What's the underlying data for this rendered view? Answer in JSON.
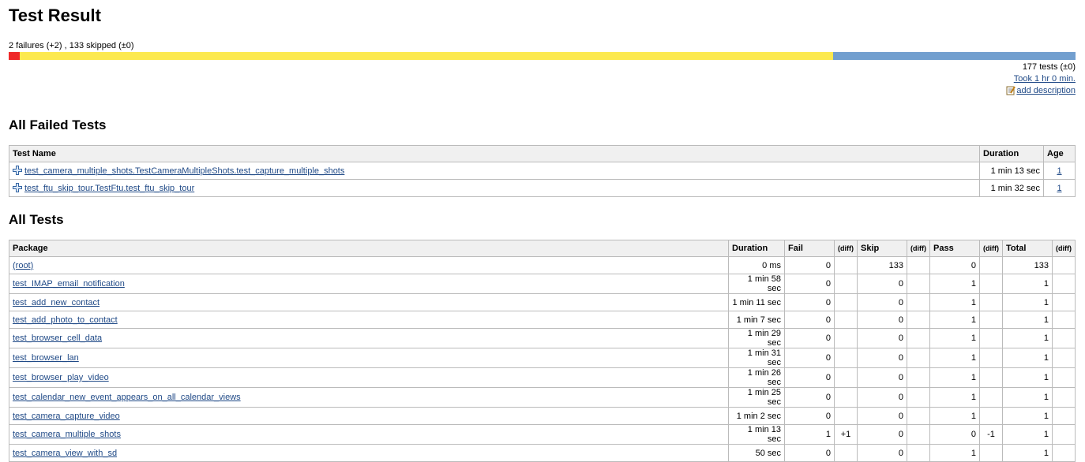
{
  "page_title": "Test Result",
  "summary_text": "2 failures (+2) , 133 skipped (±0)",
  "progress": {
    "fail_fraction": 0.0104,
    "skip_fraction": 0.7625,
    "pass_fraction": 0.2271,
    "colors": {
      "fail": "#ef2929",
      "skip": "#fce94f",
      "pass": "#729fcf"
    }
  },
  "tests_total_text": "177 tests (±0)",
  "took_text": "Took 1 hr 0 min.",
  "add_description": "add description",
  "failed_section": {
    "title": "All Failed Tests",
    "headers": {
      "name": "Test Name",
      "duration": "Duration",
      "age": "Age"
    },
    "rows": [
      {
        "name": "test_camera_multiple_shots.TestCameraMultipleShots.test_capture_multiple_shots",
        "duration": "1 min 13 sec",
        "age": "1"
      },
      {
        "name": "test_ftu_skip_tour.TestFtu.test_ftu_skip_tour",
        "duration": "1 min 32 sec",
        "age": "1"
      }
    ]
  },
  "all_section": {
    "title": "All Tests",
    "headers": {
      "package": "Package",
      "duration": "Duration",
      "fail": "Fail",
      "diff": "(diff)",
      "skip": "Skip",
      "pass": "Pass",
      "total": "Total"
    },
    "rows": [
      {
        "package": "(root)",
        "duration": "0 ms",
        "fail": "0",
        "fail_diff": "",
        "skip": "133",
        "skip_diff": "",
        "pass": "0",
        "pass_diff": "",
        "total": "133",
        "total_diff": ""
      },
      {
        "package": "test_IMAP_email_notification",
        "duration": "1 min 58 sec",
        "fail": "0",
        "fail_diff": "",
        "skip": "0",
        "skip_diff": "",
        "pass": "1",
        "pass_diff": "",
        "total": "1",
        "total_diff": ""
      },
      {
        "package": "test_add_new_contact",
        "duration": "1 min 11 sec",
        "fail": "0",
        "fail_diff": "",
        "skip": "0",
        "skip_diff": "",
        "pass": "1",
        "pass_diff": "",
        "total": "1",
        "total_diff": ""
      },
      {
        "package": "test_add_photo_to_contact",
        "duration": "1 min 7 sec",
        "fail": "0",
        "fail_diff": "",
        "skip": "0",
        "skip_diff": "",
        "pass": "1",
        "pass_diff": "",
        "total": "1",
        "total_diff": ""
      },
      {
        "package": "test_browser_cell_data",
        "duration": "1 min 29 sec",
        "fail": "0",
        "fail_diff": "",
        "skip": "0",
        "skip_diff": "",
        "pass": "1",
        "pass_diff": "",
        "total": "1",
        "total_diff": ""
      },
      {
        "package": "test_browser_lan",
        "duration": "1 min 31 sec",
        "fail": "0",
        "fail_diff": "",
        "skip": "0",
        "skip_diff": "",
        "pass": "1",
        "pass_diff": "",
        "total": "1",
        "total_diff": ""
      },
      {
        "package": "test_browser_play_video",
        "duration": "1 min 26 sec",
        "fail": "0",
        "fail_diff": "",
        "skip": "0",
        "skip_diff": "",
        "pass": "1",
        "pass_diff": "",
        "total": "1",
        "total_diff": ""
      },
      {
        "package": "test_calendar_new_event_appears_on_all_calendar_views",
        "duration": "1 min 25 sec",
        "fail": "0",
        "fail_diff": "",
        "skip": "0",
        "skip_diff": "",
        "pass": "1",
        "pass_diff": "",
        "total": "1",
        "total_diff": ""
      },
      {
        "package": "test_camera_capture_video",
        "duration": "1 min 2 sec",
        "fail": "0",
        "fail_diff": "",
        "skip": "0",
        "skip_diff": "",
        "pass": "1",
        "pass_diff": "",
        "total": "1",
        "total_diff": ""
      },
      {
        "package": "test_camera_multiple_shots",
        "duration": "1 min 13 sec",
        "fail": "1",
        "fail_diff": "+1",
        "skip": "0",
        "skip_diff": "",
        "pass": "0",
        "pass_diff": "-1",
        "total": "1",
        "total_diff": ""
      },
      {
        "package": "test_camera_view_with_sd",
        "duration": "50 sec",
        "fail": "0",
        "fail_diff": "",
        "skip": "0",
        "skip_diff": "",
        "pass": "1",
        "pass_diff": "",
        "total": "1",
        "total_diff": ""
      }
    ]
  }
}
